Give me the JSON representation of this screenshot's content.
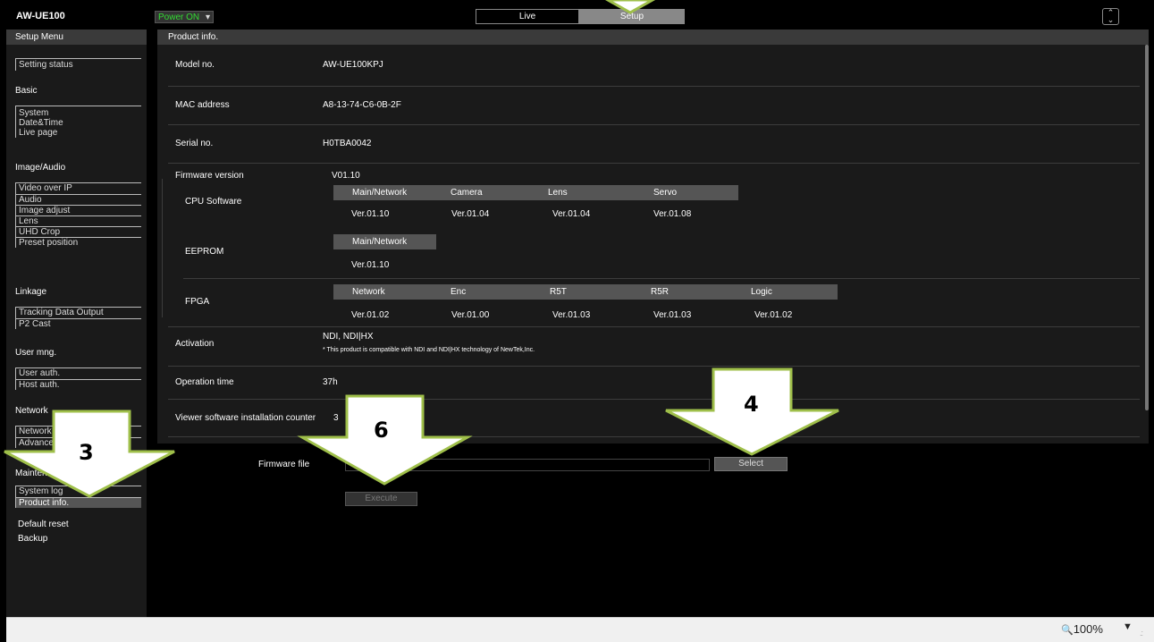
{
  "header": {
    "app_title": "AW-UE100",
    "power": "Power ON",
    "tabs": [
      "Live",
      "Setup"
    ],
    "collapse_icon": "chevron-updown-icon"
  },
  "sidebar": {
    "title": "Setup Menu",
    "setting_status": "Setting status",
    "groups": [
      {
        "label": "Basic",
        "items": [
          "System",
          "Date&Time",
          "Live page"
        ]
      },
      {
        "label": "Image/Audio",
        "items": [
          "Video over IP",
          "Audio",
          "Image adjust",
          "Lens",
          "UHD Crop",
          "Preset position"
        ]
      },
      {
        "label": "Linkage",
        "items": [
          "Tracking Data Output",
          "P2 Cast"
        ]
      },
      {
        "label": "User mng.",
        "items": [
          "User auth.",
          "Host auth."
        ]
      },
      {
        "label": "Network",
        "items": [
          "Network",
          "Advanced"
        ]
      },
      {
        "label": "Maintenance",
        "items": [
          "System log",
          "Product info.",
          "Default reset",
          "Backup"
        ]
      }
    ],
    "active_item": "Product info."
  },
  "main": {
    "title": "Product info.",
    "model_label": "Model no.",
    "model_value": "AW-UE100KPJ",
    "mac_label": "MAC address",
    "mac_value": "A8-13-74-C6-0B-2F",
    "serial_label": "Serial no.",
    "serial_value": "H0TBA0042",
    "firmware_label": "Firmware version",
    "firmware_value": "V01.10",
    "cpu": {
      "label": "CPU Software",
      "headers": [
        "Main/Network",
        "Camera",
        "Lens",
        "Servo"
      ],
      "values": [
        "Ver.01.10",
        "Ver.01.04",
        "Ver.01.04",
        "Ver.01.08"
      ]
    },
    "eeprom": {
      "label": "EEPROM",
      "headers": [
        "Main/Network"
      ],
      "values": [
        "Ver.01.10"
      ]
    },
    "fpga": {
      "label": "FPGA",
      "headers": [
        "Network",
        "Enc",
        "R5T",
        "R5R",
        "Logic"
      ],
      "values": [
        "Ver.01.02",
        "Ver.01.00",
        "Ver.01.03",
        "Ver.01.03",
        "Ver.01.02"
      ]
    },
    "activation_label": "Activation",
    "activation_value": "NDI, NDI|HX",
    "activation_note": "* This product is compatible with NDI and NDI|HX technology of NewTek,Inc.",
    "operation_label": "Operation time",
    "operation_value": "37h",
    "viewer_label": "Viewer software installation counter",
    "viewer_value": "3"
  },
  "firmware_update": {
    "file_label": "Firmware file",
    "file_value": "",
    "select_label": "Select",
    "execute_label": "Execute"
  },
  "statusbar": {
    "zoom": "100%",
    "zoom_icon": "magnifier-icon"
  },
  "annotations": [
    "3",
    "6",
    "4"
  ],
  "colors": {
    "power_on": "#33dd33",
    "arrow_fill": "#ffffff",
    "arrow_stroke": "#9fbf4a"
  }
}
